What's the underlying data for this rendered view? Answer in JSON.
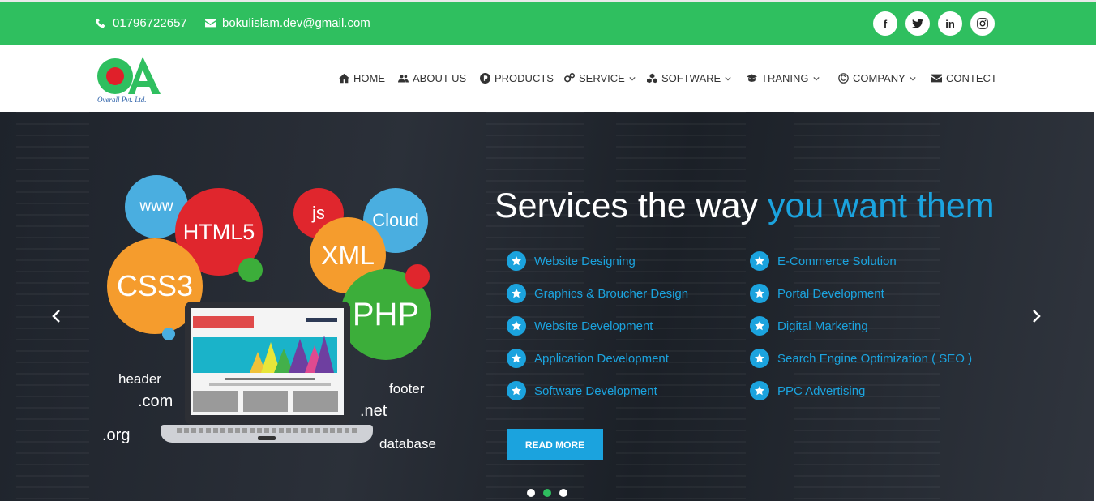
{
  "topbar": {
    "phone": "01796722657",
    "email": "bokulislam.dev@gmail.com",
    "social": [
      "facebook-icon",
      "twitter-icon",
      "linkedin-icon",
      "instagram-icon"
    ]
  },
  "logo": {
    "text": "Overall Pvt. Ltd."
  },
  "nav": {
    "home": "HOME",
    "about": "ABOUT US",
    "products": "PRODUCTS",
    "service": "SERVICE",
    "software": "SOFTWARE",
    "traning": "TRANING",
    "company": "COMPANY",
    "contect": "CONTECT"
  },
  "hero": {
    "title_main": "Services the way ",
    "title_accent": "you want them",
    "services_left": [
      "Website Designing",
      "Graphics & Broucher Design",
      "Website Development",
      "Application Development",
      "Software Development"
    ],
    "services_right": [
      "E-Commerce Solution",
      "Portal Development",
      "Digital Marketing",
      "Search Engine Optimization ( SEO )",
      "PPC Advertising"
    ],
    "read_more": "READ MORE",
    "illustration": {
      "bubbles": [
        "www",
        "HTML5",
        "js",
        "Cloud",
        "CSS3",
        "XML",
        "PHP"
      ],
      "words": [
        "header",
        ".com",
        ".org",
        "footer",
        ".net",
        "database"
      ]
    }
  },
  "colors": {
    "brand_green": "#2fbf5f",
    "accent_blue": "#1ba3de"
  }
}
